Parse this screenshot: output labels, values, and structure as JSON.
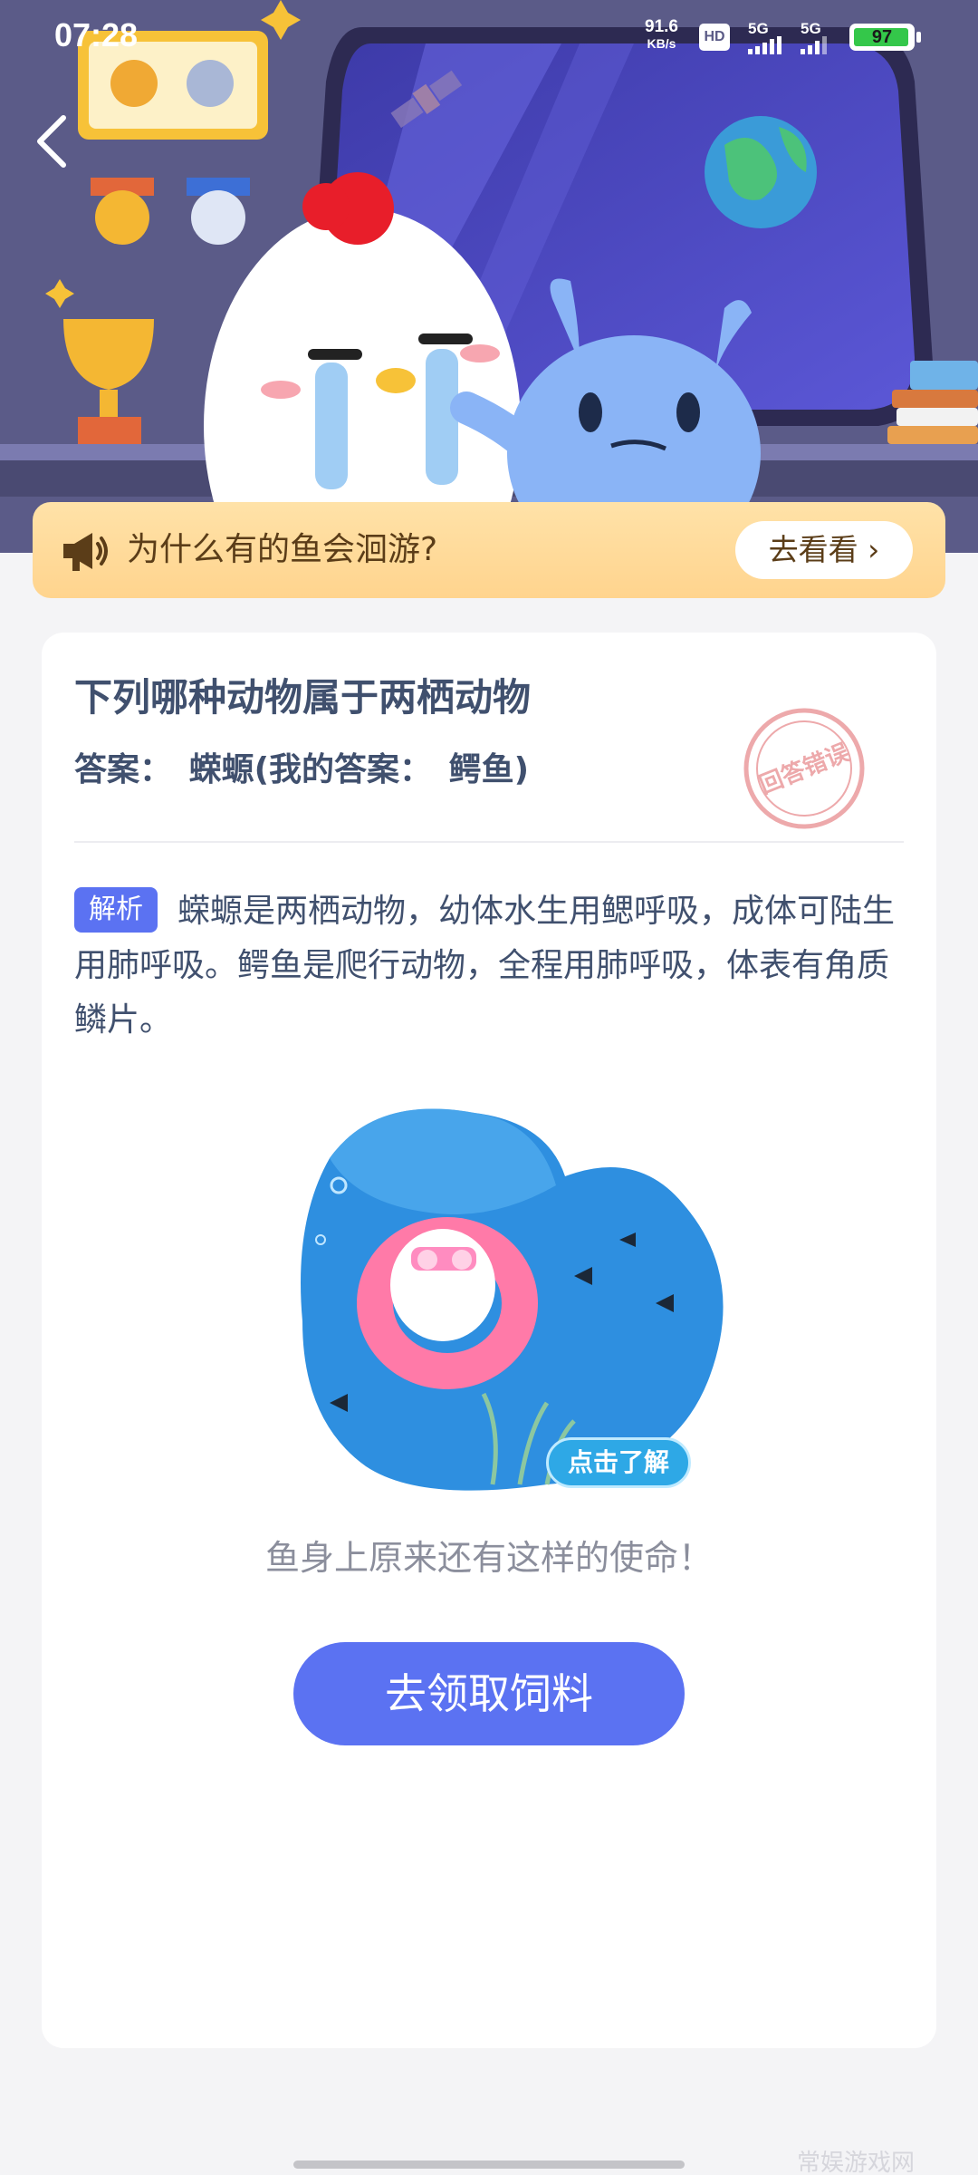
{
  "status_bar": {
    "time": "07:28",
    "net_speed_value": "91.6",
    "net_speed_unit": "KB/s",
    "hd_label": "HD",
    "signal1_label": "5G",
    "signal2_label": "5G",
    "battery_level": 97,
    "battery_label": "97"
  },
  "banner": {
    "text": "为什么有的鱼会洄游?",
    "button_label": "去看看 ›"
  },
  "question": {
    "title": "下列哪种动物属于两栖动物",
    "answer_label": "答案：",
    "answer_value": "蝾螈(我的答案：",
    "my_answer_value": "鳄鱼)",
    "stamp_text": "回答错误"
  },
  "analysis": {
    "tag": "解析",
    "text": "蝾螈是两栖动物，幼体水生用鳃呼吸，成体可陆生用肺呼吸。鳄鱼是爬行动物，全程用肺呼吸，体表有角质鳞片。"
  },
  "promo": {
    "badge": "点击了解",
    "caption": "鱼身上原来还有这样的使命！",
    "cta_label": "去领取饲料"
  },
  "watermark": "常娱游戏网",
  "colors": {
    "accent": "#5b72f2",
    "banner_bg": "#ffd48e",
    "hero_bg": "#5a5a86",
    "text": "#40506e",
    "stamp": "#e88d90"
  }
}
